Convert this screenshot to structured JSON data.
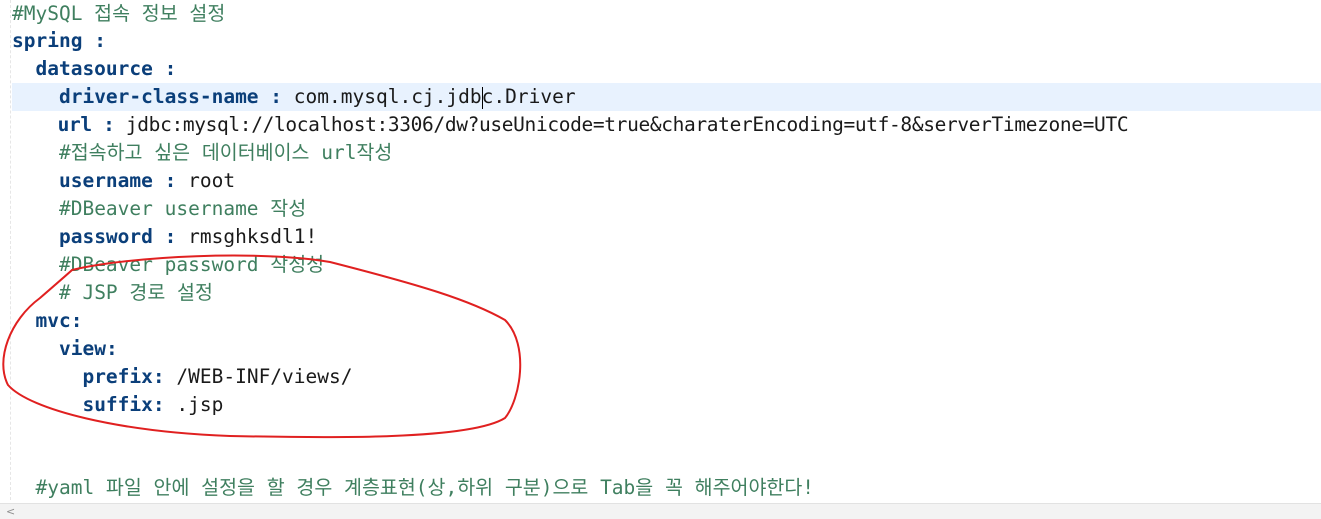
{
  "editor": {
    "lines": [
      {
        "indent": "",
        "comment": "#MySQL 접속 정보 설정"
      },
      {
        "indent": "",
        "key": "spring",
        "sep": " :"
      },
      {
        "indent": "  ",
        "key": "datasource",
        "sep": " :"
      },
      {
        "indent": "    ",
        "key": "driver-class-name",
        "sep": " : ",
        "value_a": "com.mysql.cj.jdb",
        "value_b": "c.Driver",
        "current": true
      },
      {
        "indent": "    ",
        "key": "url",
        "sep": " : ",
        "value": "jdbc:mysql://localhost:3306/dw?useUnicode=true&charaterEncoding=utf-8&serverTimezone=UTC"
      },
      {
        "indent": "    ",
        "comment": "#접속하고 싶은 데이터베이스 url작성"
      },
      {
        "indent": "    ",
        "key": "username",
        "sep": " : ",
        "value": "root"
      },
      {
        "indent": "    ",
        "comment": "#DBeaver username 작성"
      },
      {
        "indent": "    ",
        "key": "password",
        "sep": " : ",
        "value": "rmsghksdl1!"
      },
      {
        "indent": "    ",
        "comment": "#DBeaver password 작성성"
      },
      {
        "indent": "    ",
        "comment": "# JSP 경로 설정"
      },
      {
        "indent": "  ",
        "key": "mvc",
        "sep": ":"
      },
      {
        "indent": "    ",
        "key": "view",
        "sep": ":"
      },
      {
        "indent": "      ",
        "key": "prefix",
        "sep": ": ",
        "value": "/WEB-INF/views/"
      },
      {
        "indent": "      ",
        "key": "suffix",
        "sep": ": ",
        "value": ".jsp"
      },
      {
        "indent": ""
      },
      {
        "indent": ""
      },
      {
        "indent": "  ",
        "comment": "#yaml 파일 안에 설정을 할 경우 계층표현(상,하위 구분)으로 Tab을 꼭 해주어야한다!"
      }
    ]
  },
  "scrollbar": {
    "left_arrow": "<"
  },
  "colors": {
    "key": "#0b3f7a",
    "comment": "#3f7f5f",
    "value": "#1a1a1a",
    "current_line": "#e8f2fe",
    "annotation": "#e02020"
  }
}
